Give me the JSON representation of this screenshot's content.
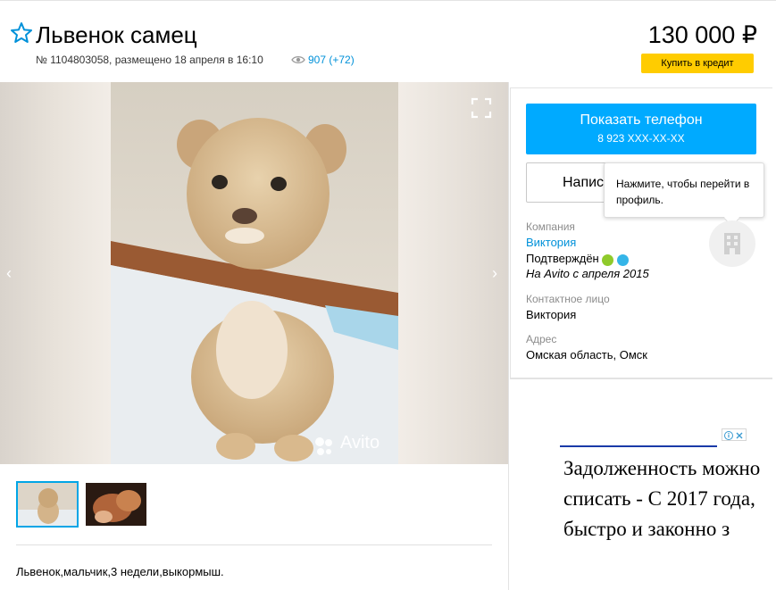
{
  "listing": {
    "title": "Львенок самец",
    "meta": "№ 1104803058, размещено 18 апреля в 16:10",
    "views": "907 (+72)",
    "price": "130 000 ₽",
    "credit_button": "Купить в кредит"
  },
  "gallery": {
    "watermark": "Avito",
    "icons": [
      "star-icon",
      "eye-icon",
      "fullscreen-icon",
      "arrow-left-icon",
      "arrow-right-icon",
      "avito-logo-icon"
    ]
  },
  "description": "Львенок,мальчик,3 недели,выкормыш.",
  "contact": {
    "phone_button": "Показать телефон",
    "phone_number": "8 923 XXX-XX-XX",
    "write_button": "Напис",
    "tooltip": "Нажмите, чтобы перейти в профиль.",
    "company_label": "Компания",
    "company_name": "Виктория",
    "confirmed": "Подтверждён",
    "since": "На Avito с апреля 2015",
    "contact_label": "Контактное лицо",
    "contact_name": "Виктория",
    "address_label": "Адрес",
    "address": "Омская область, Омск"
  },
  "ad": {
    "text": "Задолженность можно списать - С 2017 года, быстро и законно з"
  },
  "colors": {
    "accent_blue": "#00aaff",
    "link": "#0091d9",
    "credit_yellow": "#ffcc00"
  }
}
